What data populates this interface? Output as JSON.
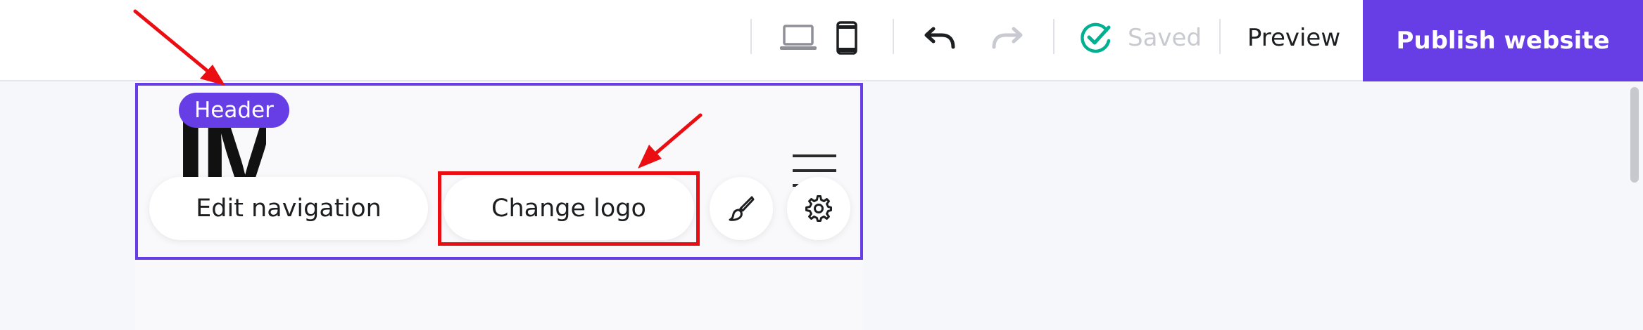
{
  "toolbar": {
    "saved_label": "Saved",
    "preview_label": "Preview",
    "publish_label": "Publish website",
    "icons": [
      "desktop-view-icon",
      "mobile-view-icon",
      "undo-icon",
      "redo-icon",
      "saved-check-icon"
    ]
  },
  "editor": {
    "section_badge": "Header",
    "logo_text": "IM",
    "actions": {
      "edit_navigation": "Edit navigation",
      "change_logo": "Change logo",
      "style_icon": "paintbrush-icon",
      "settings_icon": "gear-icon"
    }
  },
  "colors": {
    "accent": "#673de6",
    "saved_check": "#00b090",
    "annotation": "#ea0d12",
    "disabled": "#c9cad1"
  }
}
